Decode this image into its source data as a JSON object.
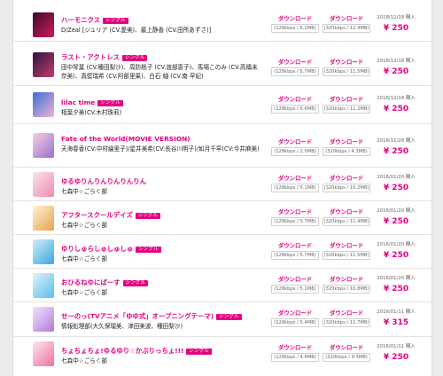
{
  "labels": {
    "download": "ダウンロード",
    "badge": "シングル"
  },
  "colors": {
    "accent": "#e4007f",
    "background": "#ececec",
    "panel": "#ffffff"
  },
  "items": [
    {
      "title": "ハーモニクス",
      "artist": "D/Zeal [ジュリア (CV.愛美)、最上静香 (CV.田所あずさ)]",
      "low": "(128kbps / 6.1MB)",
      "high": "(320kbps / 12.4MB)",
      "date": "2018/12/18 購入",
      "price": "¥ 250",
      "art_colors": [
        "#3a0b2a",
        "#d21a5a"
      ]
    },
    {
      "title": "ラスト・アクトレス",
      "artist": "田中琴葉 (CV.種田梨沙)、周防桃子 (CV.渡部恵子)、馬場このみ (CV.高橋未奈美)、真壁瑞希 (CV.阿部里果)、白石 紬 (CV.南 早紀)",
      "low": "(128kbps / 5.7MB)",
      "high": "(320kbps / 11.5MB)",
      "date": "2018/12/18 購入",
      "price": "¥ 250",
      "art_colors": [
        "#2b1540",
        "#c83a6a"
      ]
    },
    {
      "title": "lilac time",
      "artist": "相葉夕美(CV.木村珠莉)",
      "low": "(128kbps / 5.6MB)",
      "high": "(320kbps / 11.2MB)",
      "date": "2018/12/18 購入",
      "price": "¥ 250",
      "art_colors": [
        "#3b6fd6",
        "#f0b3cf"
      ]
    },
    {
      "title": "Fate of the World(MOVIE VERSION)",
      "artist": "天海春香(CV:中村繪里子)/星井美希(CV:長谷川明子)/如月千早(CV:今井麻美)",
      "low": "(128kbps / 2.0MB)",
      "high": "(320kbps / 4.3MB)",
      "date": "2018/11/28 購入",
      "price": "¥ 250",
      "art_colors": [
        "#f6cfe0",
        "#9a6fd0"
      ]
    },
    {
      "title": "ゆるゆりんりんりんりんりん",
      "artist": "七森中☆ごらく部",
      "low": "(128kbps / 5.1MB)",
      "high": "(320kbps / 10.2MB)",
      "date": "2016/01/20 購入",
      "price": "¥ 250",
      "art_colors": [
        "#fbe3ec",
        "#f08ab0"
      ]
    },
    {
      "title": "アフタースクールデイズ",
      "artist": "七森中☆ごらく部",
      "low": "(128kbps / 5.7MB)",
      "high": "(320kbps / 11.4MB)",
      "date": "2016/01/20 購入",
      "price": "¥ 250",
      "art_colors": [
        "#fff3d6",
        "#e9a04b"
      ]
    },
    {
      "title": "ゆりしゅらしゅしゅしゅ",
      "artist": "七森中☆ごらく部",
      "low": "(128kbps / 5.7MB)",
      "high": "(320kbps / 11.5MB)",
      "date": "2016/01/20 購入",
      "price": "¥ 250",
      "art_colors": [
        "#cfeefa",
        "#3aa6dd"
      ]
    },
    {
      "title": "おひるねゆにばーす",
      "artist": "七森中☆ごらく部",
      "low": "(128kbps / 5.1MB)",
      "high": "(320kbps / 10.8MB)",
      "date": "2016/01/20 購入",
      "price": "¥ 250",
      "art_colors": [
        "#dff3fd",
        "#5cbbe8"
      ]
    },
    {
      "title": "せーのっ(TVアニメ「ゆゆ式」オープニングテーマ)",
      "artist": "情報処理部(大久保瑠美、津田美波、種田梨沙)",
      "low": "(128kbps / 5.4MB)",
      "high": "(320kbps / 11.7MB)",
      "date": "2016/01/11 購入",
      "price": "¥ 315",
      "art_colors": [
        "#f4e4ff",
        "#b07ad8"
      ]
    },
    {
      "title": "ちょちょちょ!ゆるゆり☆かぷりっちょ!!!",
      "artist": "七森中☆ごらく部",
      "low": "(128kbps / 4.4MB)",
      "high": "(320kbps / 9.3MB)",
      "date": "2016/01/11 購入",
      "price": "¥ 250",
      "art_colors": [
        "#ffe6f0",
        "#ef6fa0"
      ]
    }
  ]
}
